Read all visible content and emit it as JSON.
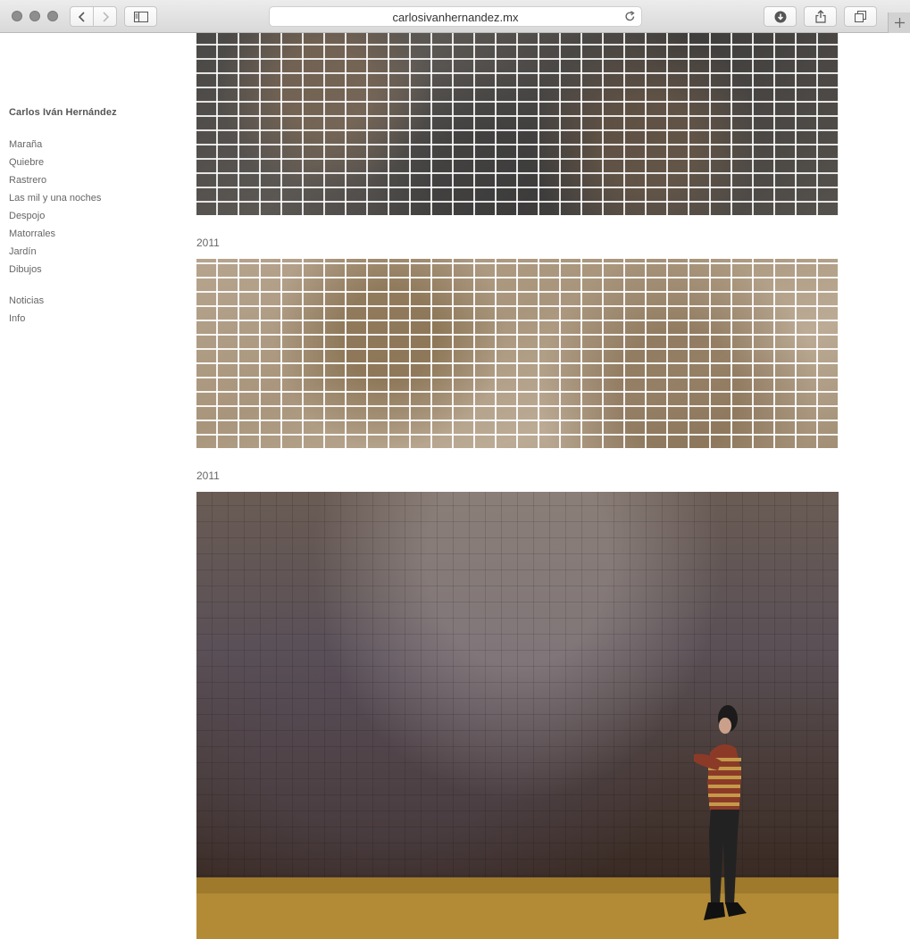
{
  "browser": {
    "url": "carlosivanhernandez.mx",
    "icons": {
      "back": "chevron-left-icon",
      "forward": "chevron-right-icon",
      "sidebar": "sidebar-icon",
      "reload": "reload-icon",
      "downloads": "download-icon",
      "share": "share-icon",
      "tabs": "tabs-overview-icon",
      "new_tab": "plus-icon"
    }
  },
  "site": {
    "title": "Carlos Iván Hernández",
    "nav_primary": [
      "Maraña",
      "Quiebre",
      "Rastrero",
      "Las mil y una noches",
      "Despojo",
      "Matorrales",
      "Jardín",
      "Dibujos"
    ],
    "nav_secondary": [
      "Noticias",
      "Info"
    ]
  },
  "gallery": {
    "captions": [
      "2011",
      "2011"
    ]
  },
  "colors": {
    "text": "#666666",
    "title": "#555555",
    "background": "#ffffff"
  }
}
